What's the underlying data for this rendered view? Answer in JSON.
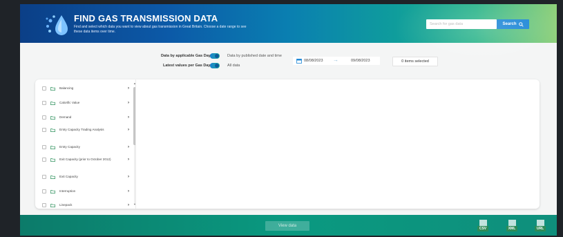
{
  "header": {
    "title": "FIND GAS TRANSMISSION DATA",
    "subtitle": "Find and select which data you want to view about gas transmission in Great Britain. Choose a date range to see these data items over time.",
    "search_placeholder": "Search for gas data",
    "search_label": "Search"
  },
  "controls": {
    "gas_day_label": "Data by applicable Gas Day",
    "published_label": "Data by published date and time",
    "latest_label": "Latest values per Gas Day",
    "all_label": "All data",
    "date_from": "08/08/2023",
    "date_to": "09/08/2023",
    "items_selected": "0 items selected"
  },
  "list": {
    "items": [
      {
        "label": "Balancing"
      },
      {
        "label": "Calorific Value"
      },
      {
        "label": "Demand"
      },
      {
        "label": "Entry Capacity Trading Analysis"
      },
      {
        "label": "Entry Capacity"
      },
      {
        "label": "Exit Capacity (prior to October 2012)"
      },
      {
        "label": "Exit Capacity"
      },
      {
        "label": "Interruption"
      },
      {
        "label": "Linepack"
      }
    ]
  },
  "footer": {
    "view_label": "View data",
    "downloads": [
      {
        "label": "CSV",
        "color": "#2e8b57"
      },
      {
        "label": "XML",
        "color": "#2e8b57"
      },
      {
        "label": "URL",
        "color": "#2e8b57"
      }
    ]
  },
  "colors": {
    "brand": "#0c5aa8",
    "accent": "#1b86d6",
    "footer": "#0a9980"
  }
}
